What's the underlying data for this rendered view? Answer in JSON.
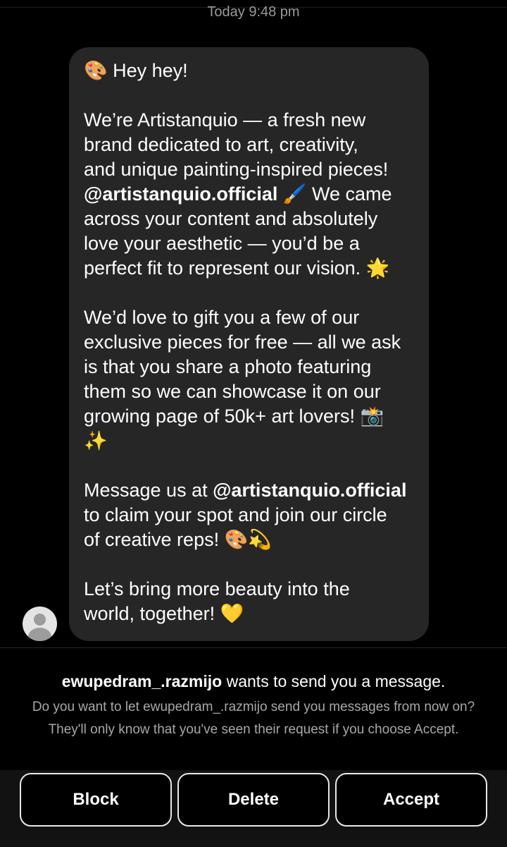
{
  "thread": {
    "timestamp": "Today 9:48 pm"
  },
  "message": {
    "lines": [
      {
        "parts": [
          {
            "t": "🎨",
            "emoji": true
          },
          {
            "t": " Hey hey!"
          }
        ]
      },
      {
        "parts": []
      },
      {
        "parts": [
          {
            "t": "We’re Artistanquio — a fresh new"
          }
        ]
      },
      {
        "parts": [
          {
            "t": "brand dedicated to art, creativity,"
          }
        ]
      },
      {
        "parts": [
          {
            "t": "and unique painting-inspired pieces!"
          }
        ]
      },
      {
        "parts": [
          {
            "t": "@artistanquio.official",
            "bold": true
          },
          {
            "t": " "
          },
          {
            "t": "🖌️",
            "emoji": true
          },
          {
            "t": " We came"
          }
        ]
      },
      {
        "parts": [
          {
            "t": "across your content and absolutely"
          }
        ]
      },
      {
        "parts": [
          {
            "t": "love your aesthetic — you’d be a"
          }
        ]
      },
      {
        "parts": [
          {
            "t": "perfect fit to represent our vision. "
          },
          {
            "t": "🌟",
            "emoji": true
          }
        ]
      },
      {
        "parts": []
      },
      {
        "parts": [
          {
            "t": "We’d love to gift you a few of our"
          }
        ]
      },
      {
        "parts": [
          {
            "t": "exclusive pieces for free — all we ask"
          }
        ]
      },
      {
        "parts": [
          {
            "t": "is that you share a photo featuring"
          }
        ]
      },
      {
        "parts": [
          {
            "t": "them so we can showcase it on our"
          }
        ]
      },
      {
        "parts": [
          {
            "t": "growing page of 50k+ art lovers! "
          },
          {
            "t": "📸",
            "emoji": true
          }
        ]
      },
      {
        "parts": [
          {
            "t": "✨",
            "emoji": true
          }
        ]
      },
      {
        "parts": []
      },
      {
        "parts": [
          {
            "t": "Message us at "
          },
          {
            "t": "@artistanquio.official",
            "bold": true
          }
        ]
      },
      {
        "parts": [
          {
            "t": "to claim your spot and join our circle"
          }
        ]
      },
      {
        "parts": [
          {
            "t": "of creative reps! "
          },
          {
            "t": "🎨💫",
            "emoji": true
          }
        ]
      },
      {
        "parts": []
      },
      {
        "parts": [
          {
            "t": "Let’s bring more beauty into the"
          }
        ]
      },
      {
        "parts": [
          {
            "t": "world, together! "
          },
          {
            "t": "💛",
            "emoji": true
          }
        ]
      }
    ]
  },
  "sender": {
    "avatar_icon": "default-user-avatar-icon"
  },
  "request": {
    "username": "ewupedram_.razmijo",
    "title_suffix": " wants to send you a message.",
    "description": "Do you want to let ewupedram_.razmijo send you messages from now on? They'll only know that you've seen their request if you choose Accept."
  },
  "actions": {
    "block_label": "Block",
    "delete_label": "Delete",
    "accept_label": "Accept"
  },
  "colors": {
    "background": "#000000",
    "bubble": "#262626",
    "secondary_text": "#a8a8a8",
    "button_border": "#e8e8e8"
  }
}
